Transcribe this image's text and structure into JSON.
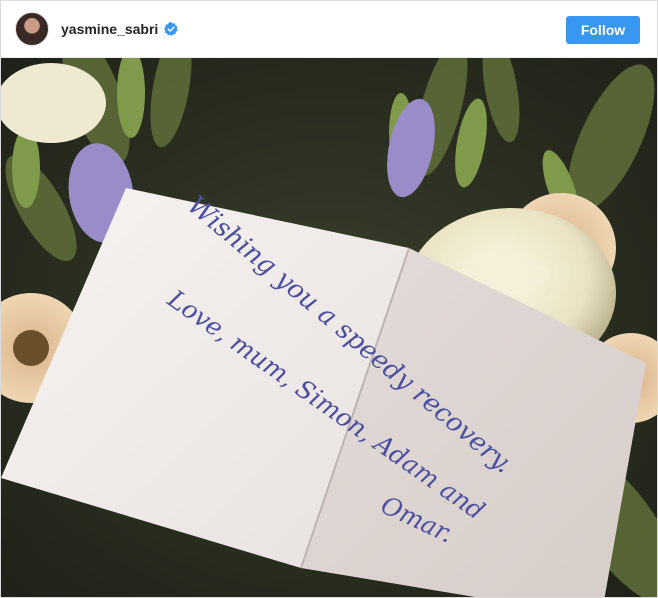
{
  "post": {
    "username": "yasmine_sabri",
    "follow_label": "Follow"
  },
  "card": {
    "line1": "Wishing you a speedy recovery.",
    "line2": "Love, mum, Simon, Adam and",
    "line3": "Omar."
  },
  "colors": {
    "follow_button": "#3897f0",
    "verified_badge": "#3897f0",
    "ink": "#4a4fa0"
  }
}
